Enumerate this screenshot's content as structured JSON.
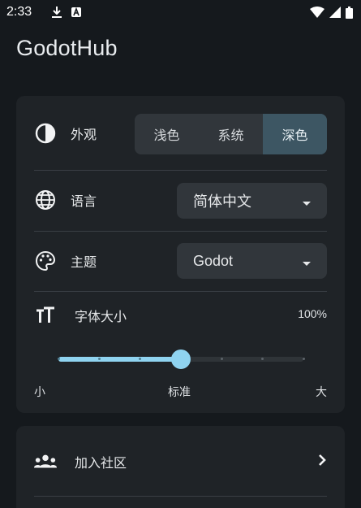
{
  "status_bar": {
    "time": "2:33",
    "icons": [
      "download-icon",
      "app-notification-icon",
      "wifi-icon",
      "signal-icon",
      "battery-icon"
    ]
  },
  "app": {
    "title": "GodotHub"
  },
  "settings": {
    "appearance": {
      "label": "外观",
      "icon": "contrast-icon",
      "options": [
        "浅色",
        "系统",
        "深色"
      ],
      "selected": "深色"
    },
    "language": {
      "label": "语言",
      "icon": "globe-icon",
      "value": "简体中文"
    },
    "theme": {
      "label": "主题",
      "icon": "palette-icon",
      "value": "Godot"
    },
    "font_size": {
      "label": "字体大小",
      "icon": "text-size-icon",
      "value_text": "100%",
      "slider": {
        "steps": 7,
        "selected_step": 3
      },
      "labels": {
        "min": "小",
        "mid": "标准",
        "max": "大"
      }
    }
  },
  "community": {
    "label": "加入社区",
    "icon": "groups-icon"
  },
  "colors": {
    "accent": "#8fd3f0",
    "background": "#15191d",
    "card": "#1f2327",
    "selected_segment": "#3d5663"
  }
}
